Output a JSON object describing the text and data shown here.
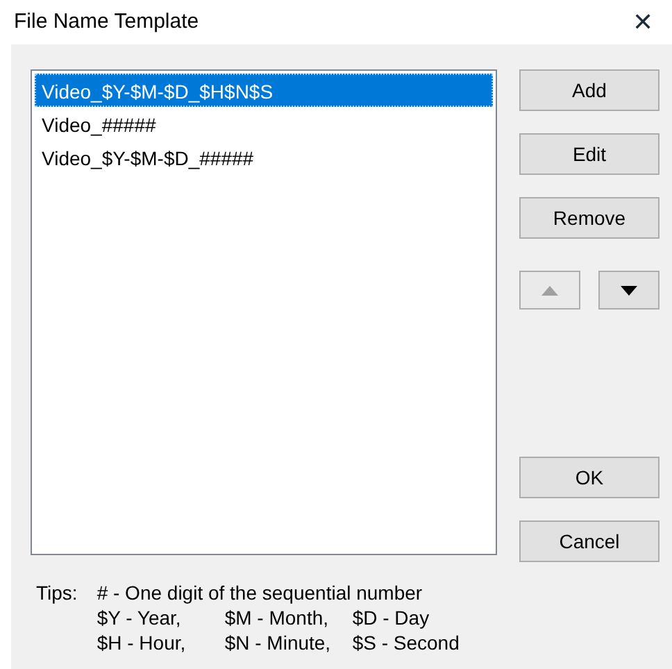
{
  "window": {
    "title": "File Name Template",
    "close": "✕"
  },
  "list": [
    {
      "text": "Video_$Y-$M-$D_$H$N$S",
      "selected": true
    },
    {
      "text": "Video_#####",
      "selected": false
    },
    {
      "text": "Video_$Y-$M-$D_#####",
      "selected": false
    }
  ],
  "buttons": [
    {
      "label": "Add"
    },
    {
      "label": "Edit"
    },
    {
      "label": "Remove"
    }
  ],
  "move_buttons": [
    {
      "kind": "up",
      "disabled": true
    },
    {
      "kind": "down",
      "disabled": false
    }
  ],
  "dialog_buttons": [
    {
      "label": "OK"
    },
    {
      "label": "Cancel"
    }
  ],
  "tips": {
    "label": "Tips:",
    "lines": [
      [
        "# - One digit of the sequential number"
      ],
      [
        "$Y - Year,",
        "$M - Month,",
        "$D - Day"
      ],
      [
        "$H - Hour,",
        "$N - Minute,",
        "$S - Second"
      ]
    ]
  }
}
